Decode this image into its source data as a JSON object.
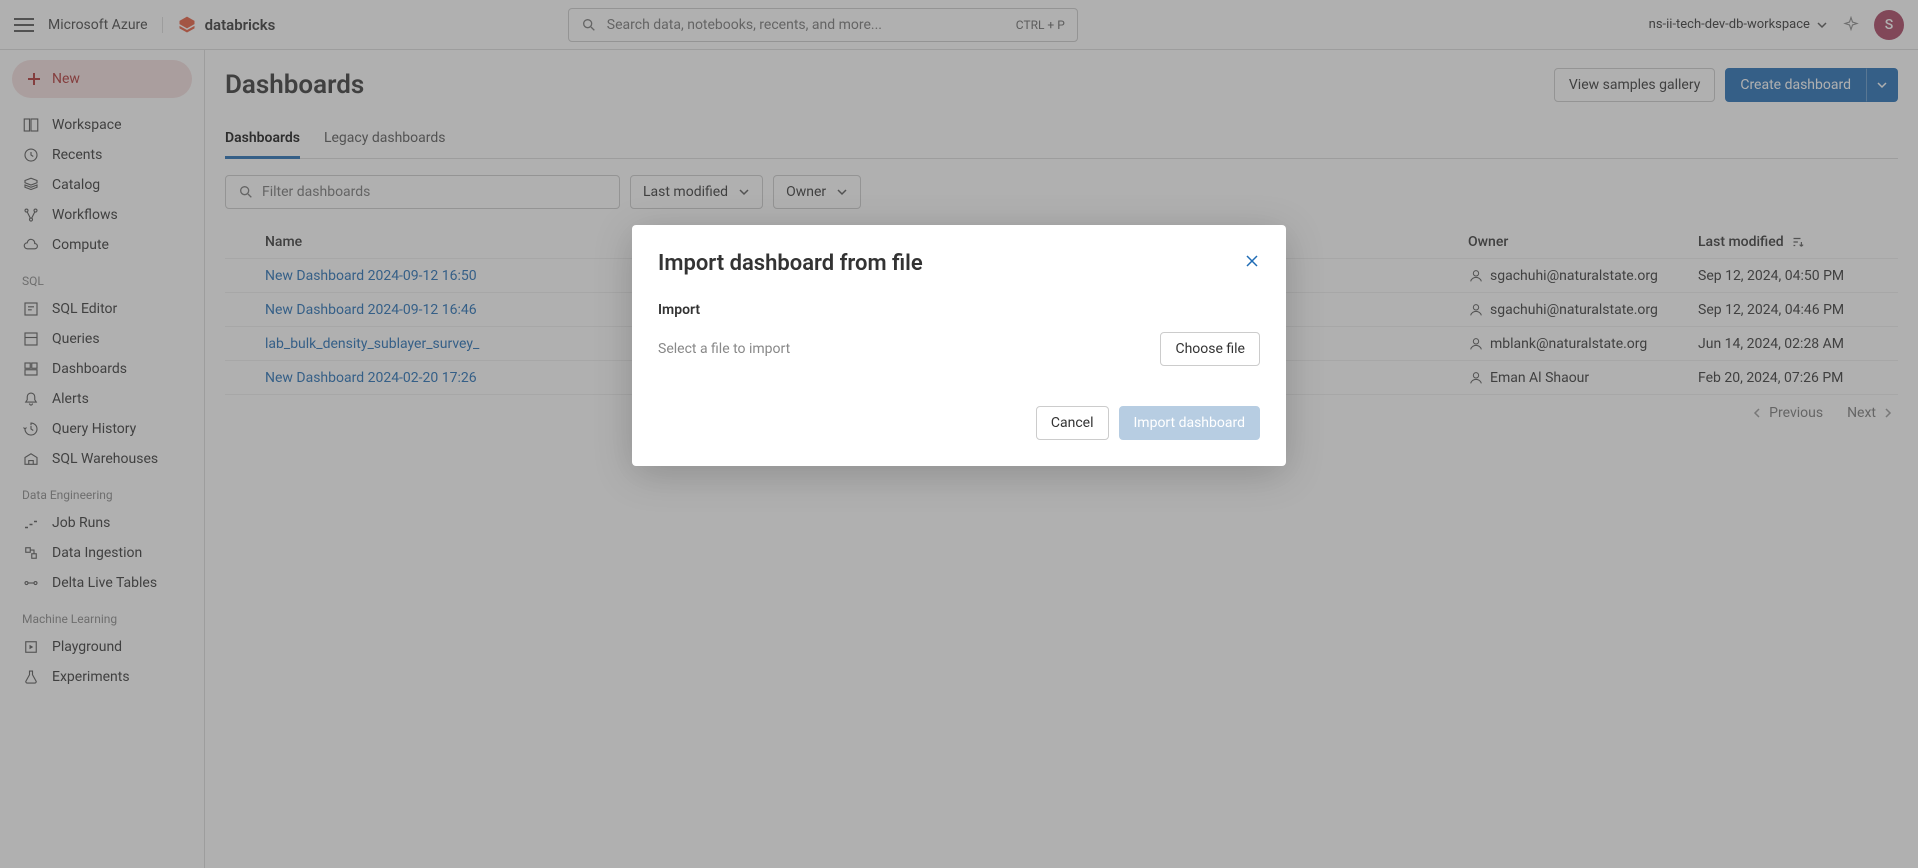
{
  "topbar": {
    "cloud": "Microsoft Azure",
    "brand": "databricks",
    "search_placeholder": "Search data, notebooks, recents, and more...",
    "search_kbd": "CTRL + P",
    "workspace": "ns-ii-tech-dev-db-workspace",
    "avatar_initial": "S"
  },
  "sidebar": {
    "new_label": "New",
    "primary": [
      {
        "label": "Workspace"
      },
      {
        "label": "Recents"
      },
      {
        "label": "Catalog"
      },
      {
        "label": "Workflows"
      },
      {
        "label": "Compute"
      }
    ],
    "sections": [
      {
        "title": "SQL",
        "items": [
          "SQL Editor",
          "Queries",
          "Dashboards",
          "Alerts",
          "Query History",
          "SQL Warehouses"
        ]
      },
      {
        "title": "Data Engineering",
        "items": [
          "Job Runs",
          "Data Ingestion",
          "Delta Live Tables"
        ]
      },
      {
        "title": "Machine Learning",
        "items": [
          "Playground",
          "Experiments"
        ]
      }
    ]
  },
  "main": {
    "title": "Dashboards",
    "samples_btn": "View samples gallery",
    "create_btn": "Create dashboard",
    "tabs": [
      "Dashboards",
      "Legacy dashboards"
    ],
    "active_tab": 0,
    "filter_placeholder": "Filter dashboards",
    "sort_drop": "Last modified",
    "owner_drop": "Owner",
    "columns": {
      "name": "Name",
      "owner": "Owner",
      "modified": "Last modified"
    },
    "rows": [
      {
        "name": "New Dashboard 2024-09-12 16:50",
        "owner": "sgachuhi@naturalstate.org",
        "modified": "Sep 12, 2024, 04:50 PM"
      },
      {
        "name": "New Dashboard 2024-09-12 16:46",
        "owner": "sgachuhi@naturalstate.org",
        "modified": "Sep 12, 2024, 04:46 PM"
      },
      {
        "name": "lab_bulk_density_sublayer_survey_",
        "owner": "mblank@naturalstate.org",
        "modified": "Jun 14, 2024, 02:28 AM"
      },
      {
        "name": "New Dashboard 2024-02-20 17:26",
        "owner": "Eman Al Shaour",
        "modified": "Feb 20, 2024, 07:26 PM"
      }
    ],
    "pager": {
      "prev": "Previous",
      "next": "Next"
    }
  },
  "modal": {
    "title": "Import dashboard from file",
    "section": "Import",
    "hint": "Select a file to import",
    "choose": "Choose file",
    "cancel": "Cancel",
    "submit": "Import dashboard"
  }
}
